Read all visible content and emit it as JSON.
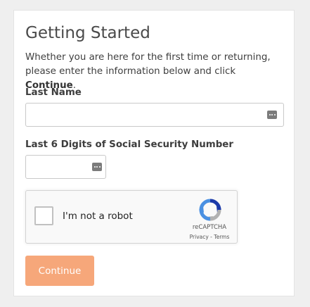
{
  "form": {
    "title": "Getting Started",
    "intro_text": "Whether you are here for the first time or returning, please enter the information below and click ",
    "intro_emphasis": "Continue",
    "intro_end": ".",
    "last_name_label": "Last Name",
    "last_name_value": "",
    "ssn_label": "Last 6 Digits of Social Security Number",
    "ssn_value": "",
    "continue_label": "Continue"
  },
  "recaptcha": {
    "checkbox_label": "I'm not a robot",
    "brand": "reCAPTCHA",
    "links": "Privacy - Terms"
  },
  "colors": {
    "continue_button": "#f6a77a",
    "recaptcha_blue": "#1c3aa9",
    "recaptcha_light_blue": "#4a90e2",
    "recaptcha_gray": "#b1b1b1"
  },
  "icons": {
    "field_icon": "password-manager-icon",
    "recaptcha_logo": "recaptcha-logo-icon"
  }
}
